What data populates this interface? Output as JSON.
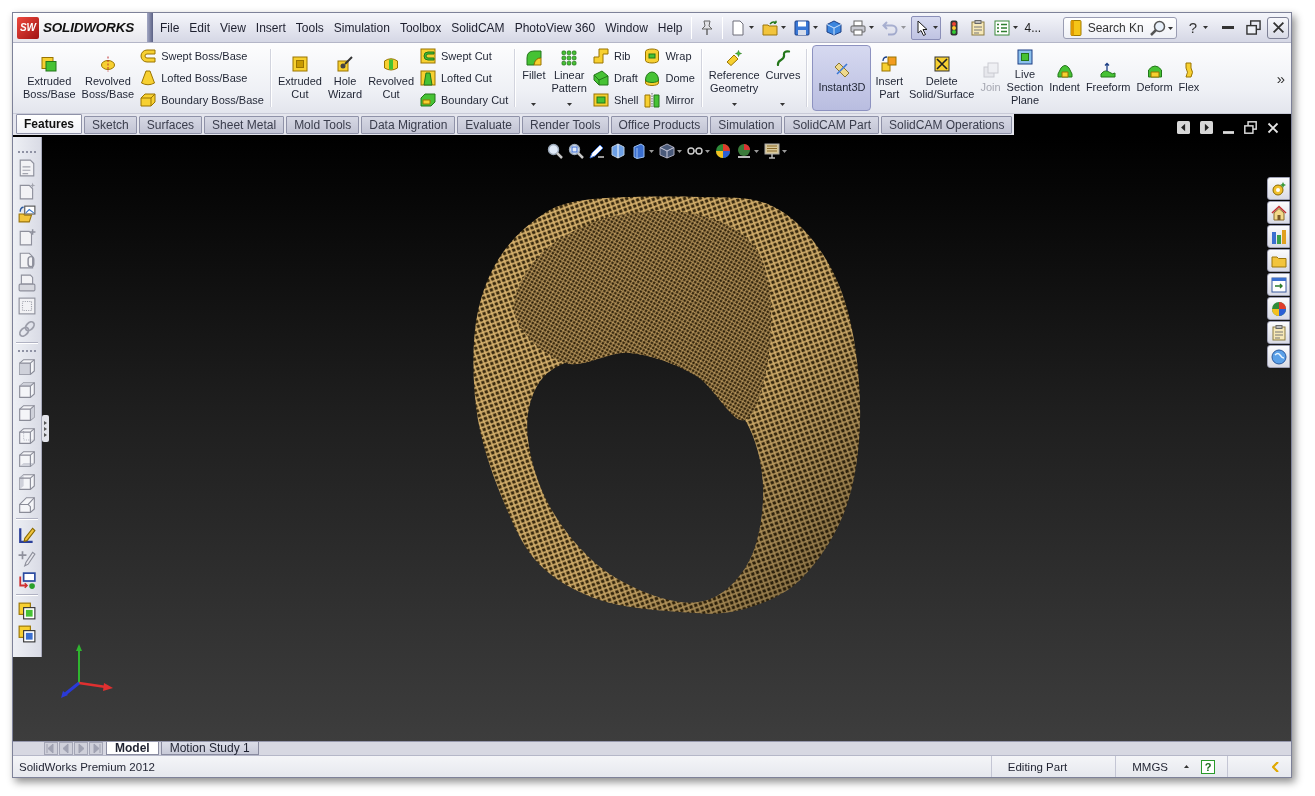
{
  "window": {
    "logo_badge": "SW",
    "logo": "SOLIDWORKS"
  },
  "menu": [
    "File",
    "Edit",
    "View",
    "Insert",
    "Tools",
    "Simulation",
    "Toolbox",
    "SolidCAM",
    "PhotoView 360",
    "Window",
    "Help"
  ],
  "quick_tools": [
    {
      "dropdown": false,
      "selected": false,
      "disabled": false
    },
    {
      "dropdown": true,
      "selected": false,
      "disabled": false
    },
    {
      "dropdown": true,
      "selected": false,
      "disabled": false
    },
    {
      "dropdown": true,
      "selected": false,
      "disabled": false
    },
    {
      "dropdown": false,
      "selected": false,
      "disabled": false
    },
    {
      "dropdown": true,
      "selected": false,
      "disabled": false
    },
    {
      "dropdown": true,
      "selected": false,
      "disabled": true
    },
    {
      "dropdown": true,
      "selected": true,
      "disabled": false
    },
    {
      "dropdown": false,
      "selected": false,
      "disabled": false
    },
    {
      "dropdown": false,
      "selected": false,
      "disabled": false
    },
    {
      "dropdown": true,
      "selected": false,
      "disabled": false
    }
  ],
  "quick_overflow": "4...",
  "search": {
    "placeholder": "Search Kn"
  },
  "help": "?",
  "ribbon": {
    "groups": [
      {
        "large": [
          {
            "label": "Extruded Boss/Base",
            "dropdown": false,
            "selected": false,
            "disabled": false
          },
          {
            "label": "Revolved Boss/Base",
            "dropdown": false,
            "selected": false,
            "disabled": false
          }
        ],
        "stacks": [
          [
            "Swept Boss/Base",
            "Lofted Boss/Base",
            "Boundary Boss/Base"
          ]
        ]
      },
      {
        "large": [
          {
            "label": "Extruded Cut",
            "dropdown": false,
            "selected": false,
            "disabled": false
          },
          {
            "label": "Hole Wizard",
            "dropdown": false,
            "selected": false,
            "disabled": false
          },
          {
            "label": "Revolved Cut",
            "dropdown": false,
            "selected": false,
            "disabled": false
          }
        ],
        "stacks": [
          [
            "Swept Cut",
            "Lofted Cut",
            "Boundary Cut"
          ]
        ]
      },
      {
        "large": [
          {
            "label": "Fillet",
            "dropdown": true,
            "selected": false,
            "disabled": false
          },
          {
            "label": "Linear Pattern",
            "dropdown": true,
            "selected": false,
            "disabled": false
          }
        ],
        "stacks": [
          [
            "Rib",
            "Draft",
            "Shell"
          ],
          [
            "Wrap",
            "Dome",
            "Mirror"
          ]
        ]
      },
      {
        "large": [
          {
            "label": "Reference Geometry",
            "dropdown": true,
            "selected": false,
            "disabled": false
          },
          {
            "label": "Curves",
            "dropdown": true,
            "selected": false,
            "disabled": false
          }
        ]
      },
      {
        "large": [
          {
            "label": "Instant3D",
            "dropdown": false,
            "selected": true,
            "disabled": false
          },
          {
            "label": "Insert Part",
            "dropdown": false,
            "selected": false,
            "disabled": false
          },
          {
            "label": "Delete Solid/Surface",
            "dropdown": false,
            "selected": false,
            "disabled": false
          },
          {
            "label": "Join",
            "dropdown": false,
            "selected": false,
            "disabled": true
          },
          {
            "label": "Live Section Plane",
            "dropdown": false,
            "selected": false,
            "disabled": false
          },
          {
            "label": "Indent",
            "dropdown": false,
            "selected": false,
            "disabled": false
          },
          {
            "label": "Freeform",
            "dropdown": false,
            "selected": false,
            "disabled": false
          },
          {
            "label": "Deform",
            "dropdown": false,
            "selected": false,
            "disabled": false
          },
          {
            "label": "Flex",
            "dropdown": false,
            "selected": false,
            "disabled": false
          }
        ]
      }
    ],
    "overflow": "»"
  },
  "tabs": [
    {
      "label": "Features",
      "selected": true
    },
    {
      "label": "Sketch",
      "selected": false
    },
    {
      "label": "Surfaces",
      "selected": false
    },
    {
      "label": "Sheet Metal",
      "selected": false
    },
    {
      "label": "Mold Tools",
      "selected": false
    },
    {
      "label": "Data Migration",
      "selected": false
    },
    {
      "label": "Evaluate",
      "selected": false
    },
    {
      "label": "Render Tools",
      "selected": false
    },
    {
      "label": "Office Products",
      "selected": false
    },
    {
      "label": "Simulation",
      "selected": false
    },
    {
      "label": "SolidCAM Part",
      "selected": false
    },
    {
      "label": "SolidCAM Operations",
      "selected": false
    }
  ],
  "sheet_tabs": [
    {
      "label": "Model",
      "selected": true
    },
    {
      "label": "Motion Study 1",
      "selected": false
    }
  ],
  "status_bar": {
    "product": "SolidWorks Premium 2012",
    "mode": "Editing Part",
    "units": "MMGS",
    "help": "?"
  }
}
